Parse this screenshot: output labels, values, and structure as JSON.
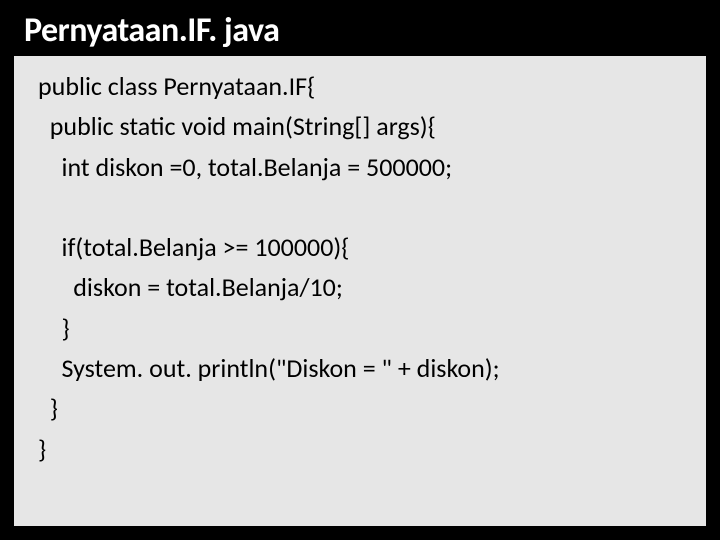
{
  "title": "Pernyataan.IF. java",
  "code": {
    "l1": "public class Pernyataan.IF{",
    "l2": "  public static void main(String[] args){",
    "l3": "    int diskon =0, total.Belanja = 500000;",
    "l4": "",
    "l5": "    if(total.Belanja >= 100000){",
    "l6": "      diskon = total.Belanja/10;",
    "l7": "    }",
    "l8": "    System. out. println(\"Diskon = \" + diskon);",
    "l9": "  }",
    "l10": "}"
  }
}
